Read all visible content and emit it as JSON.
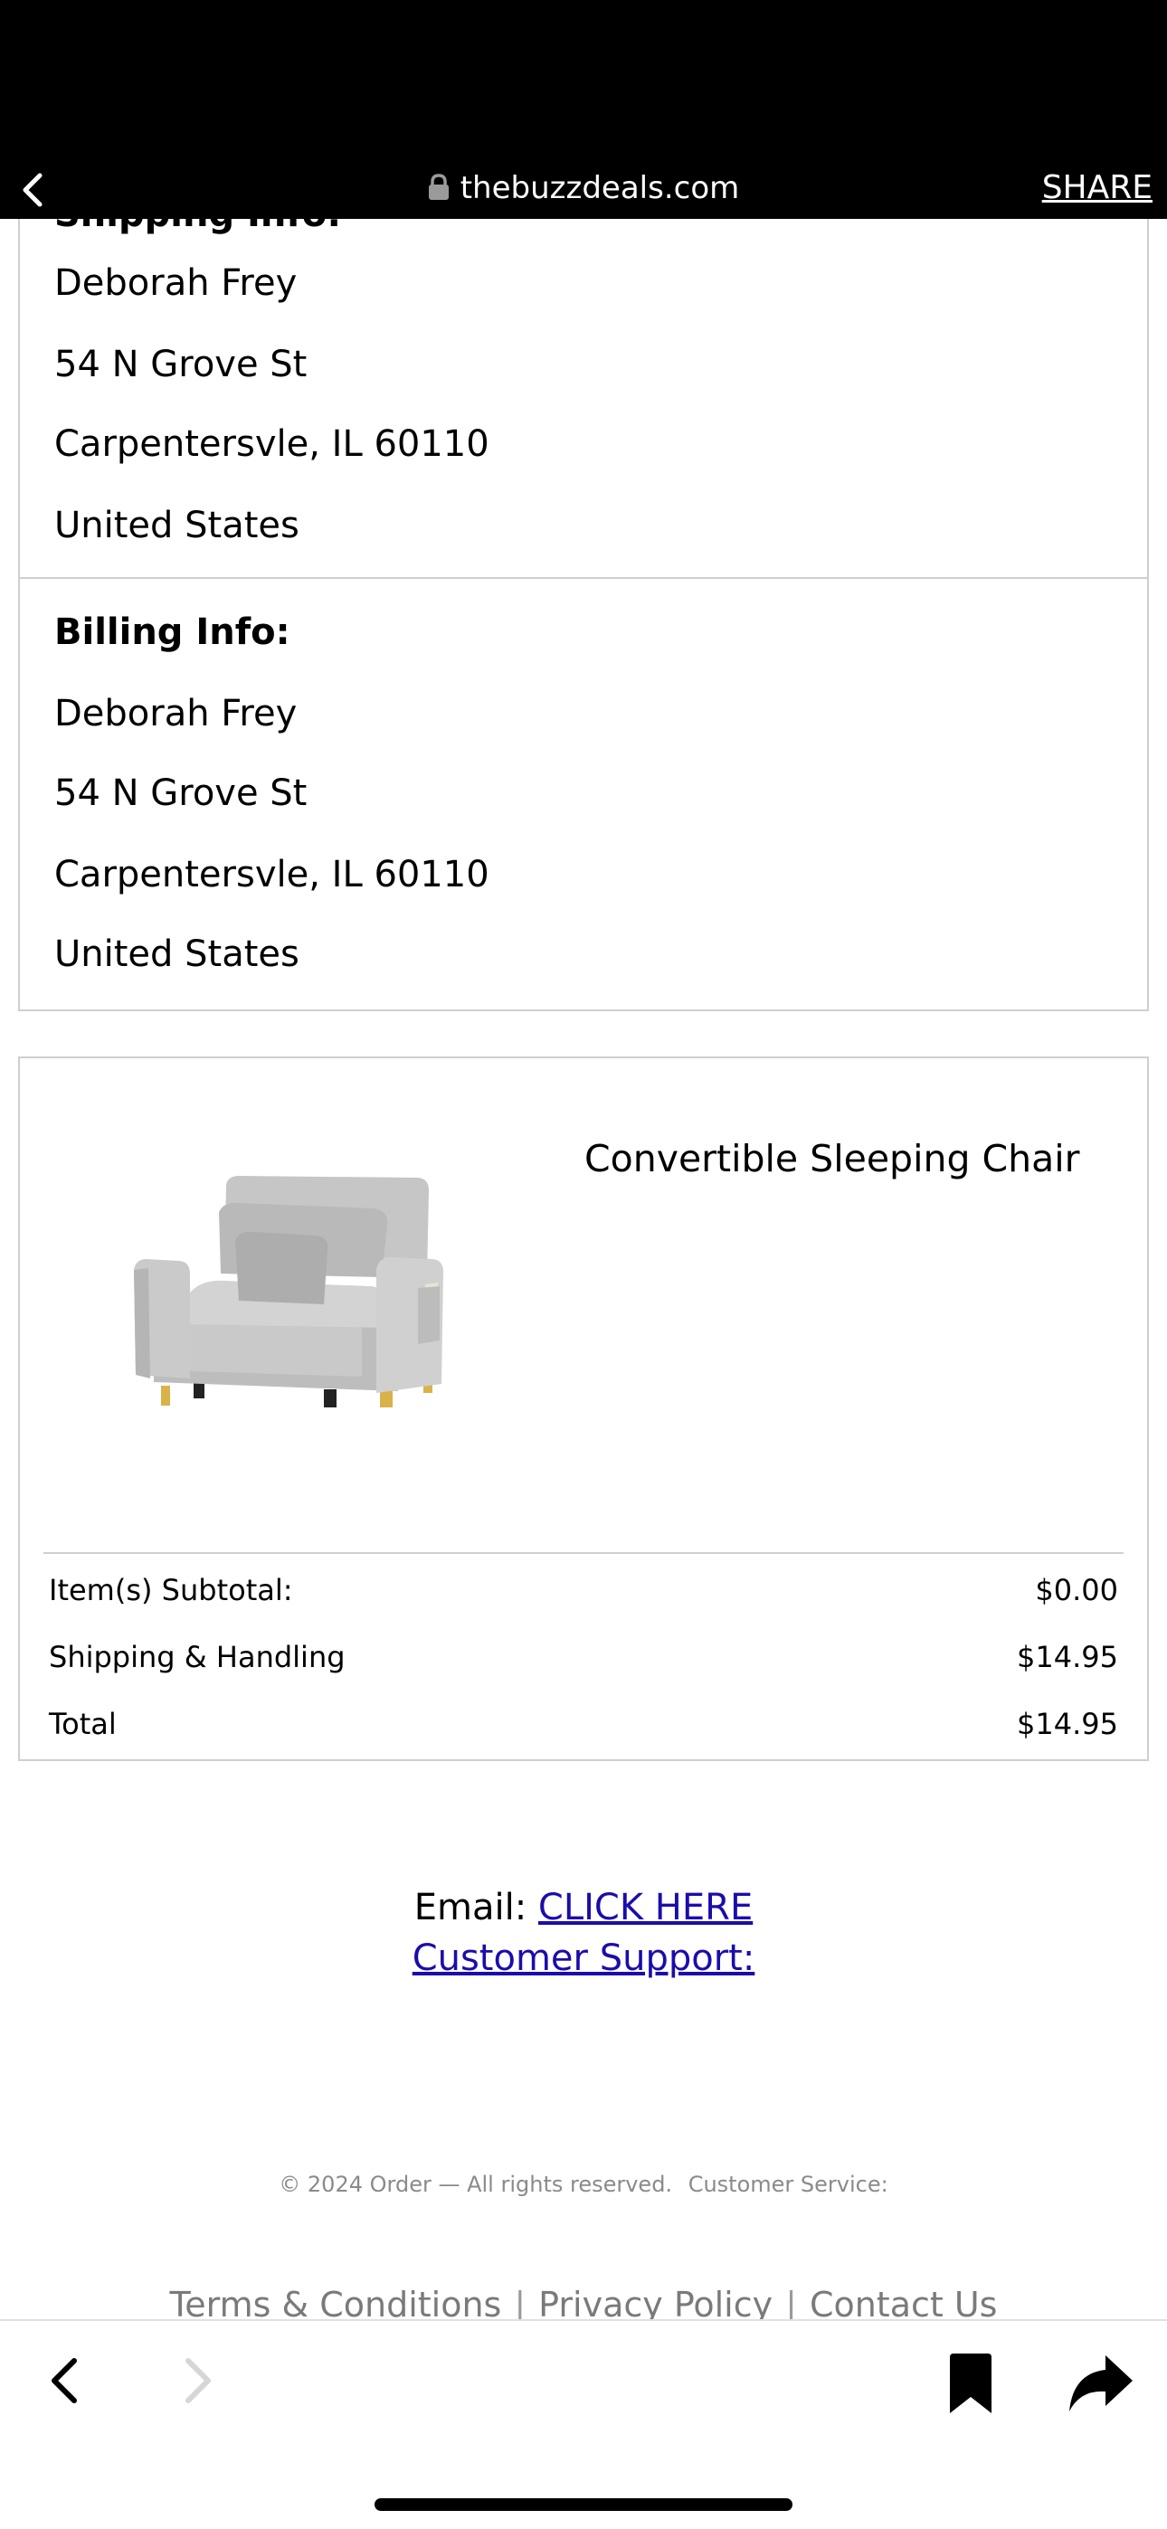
{
  "browser": {
    "url": "thebuzzdeals.com",
    "share_label": "SHARE"
  },
  "shipping": {
    "heading_partial": "Shipping Info:",
    "name": "Deborah Frey",
    "street": "54 N Grove St",
    "city_state_zip": "Carpentersvle, IL 60110",
    "country": "United States"
  },
  "billing": {
    "heading": "Billing Info:",
    "name": "Deborah Frey",
    "street": "54 N Grove St",
    "city_state_zip": "Carpentersvle, IL 60110",
    "country": "United States"
  },
  "order": {
    "product_name": "Convertible Sleeping Chair",
    "subtotal_label": "Item(s) Subtotal:",
    "subtotal_value": "$0.00",
    "shipping_label": "Shipping & Handling",
    "shipping_value": "$14.95",
    "total_label": "Total",
    "total_value": "$14.95"
  },
  "support": {
    "email_label": "Email:",
    "email_link": "CLICK HERE",
    "customer_support_link": "Customer Support:"
  },
  "footer": {
    "copyright": "© 2024 Order — All rights reserved.",
    "customer_service": "Customer Service:",
    "links": [
      "Terms & Conditions",
      "Privacy Policy",
      "Contact Us"
    ]
  },
  "icons": {
    "back": "chevron-left-icon",
    "lock": "lock-icon",
    "nav_back": "chevron-left-icon",
    "nav_forward": "chevron-right-icon",
    "bookmark": "bookmark-icon",
    "share": "share-arrow-icon"
  }
}
